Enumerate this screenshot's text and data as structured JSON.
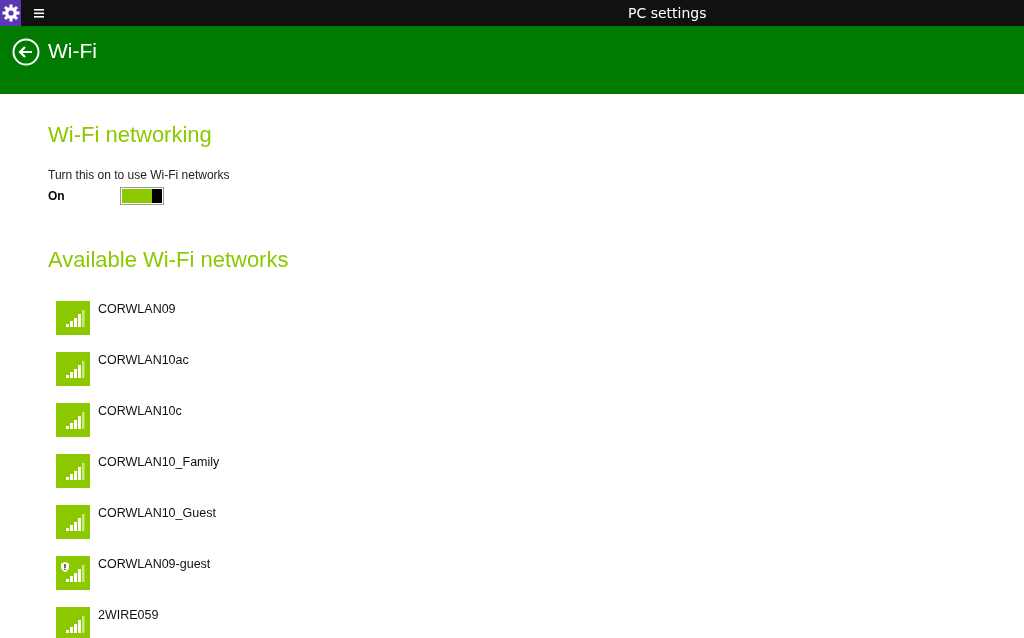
{
  "window": {
    "title": "PC settings"
  },
  "header": {
    "title": "Wi-Fi"
  },
  "wifi_networking": {
    "heading": "Wi-Fi networking",
    "description": "Turn this on to use Wi-Fi networks",
    "state_label": "On",
    "on": true
  },
  "available": {
    "heading": "Available Wi-Fi networks",
    "networks": [
      {
        "name": "CORWLAN09",
        "warning": false
      },
      {
        "name": "CORWLAN10ac",
        "warning": false
      },
      {
        "name": "CORWLAN10c",
        "warning": false
      },
      {
        "name": "CORWLAN10_Family",
        "warning": false
      },
      {
        "name": "CORWLAN10_Guest",
        "warning": false
      },
      {
        "name": "CORWLAN09-guest",
        "warning": true
      },
      {
        "name": "2WIRE059",
        "warning": false
      }
    ]
  }
}
